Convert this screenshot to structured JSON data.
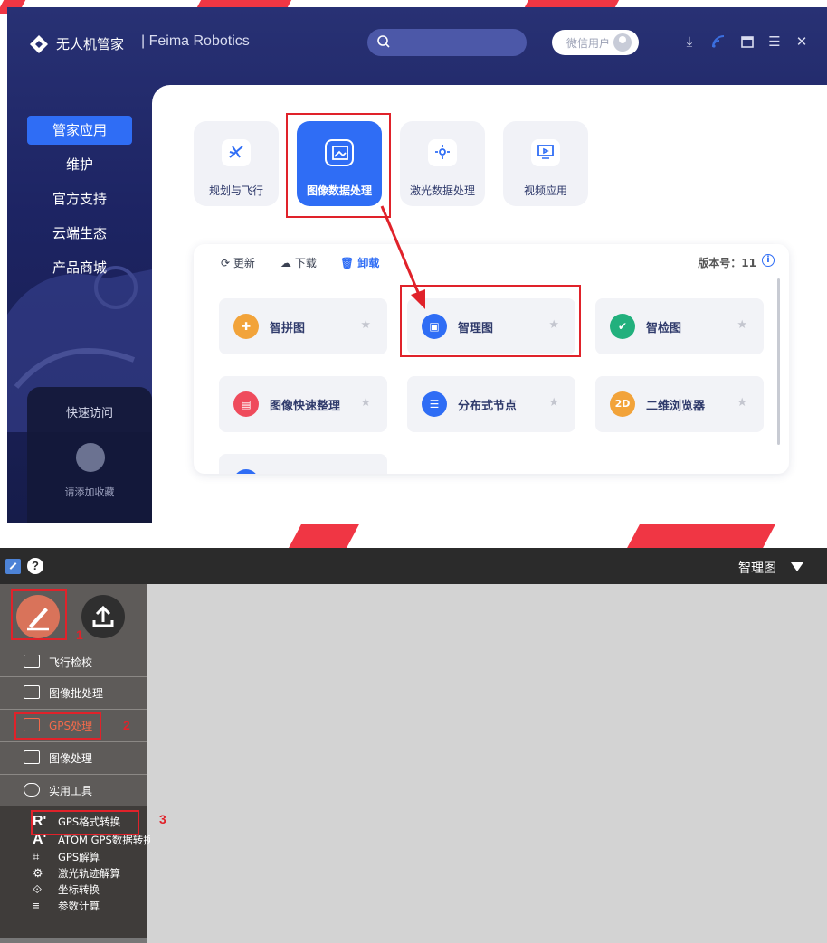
{
  "top_app": {
    "brand": "无人机管家",
    "brand_sub": "| Feima Robotics",
    "search": {
      "icon": "search-icon"
    },
    "user": {
      "label": "微信用户"
    },
    "toolbar_icons": [
      "download-icon",
      "signal-icon",
      "window-icon",
      "menu-icon",
      "close-icon"
    ],
    "sidebar": {
      "items": [
        {
          "label": "管家应用",
          "active": true
        },
        {
          "label": "维护",
          "active": false
        },
        {
          "label": "官方支持",
          "active": false
        },
        {
          "label": "云端生态",
          "active": false
        },
        {
          "label": "产品商城",
          "active": false
        }
      ],
      "quick_access": {
        "title": "快速访问",
        "hint": "请添加收藏"
      }
    },
    "categories": [
      {
        "label": "规划与飞行",
        "icon": "plane-icon",
        "active": false
      },
      {
        "label": "图像数据处理",
        "icon": "image-icon",
        "active": true
      },
      {
        "label": "激光数据处理",
        "icon": "laser-icon",
        "active": false
      },
      {
        "label": "视频应用",
        "icon": "video-icon",
        "active": false
      }
    ],
    "app_toolbar": {
      "update": "更新",
      "download": "下载",
      "uninstall": "卸载",
      "version": "版本号：11"
    },
    "apps": [
      {
        "label": "智拼图",
        "color": "#f2a33a",
        "glyph": "✚"
      },
      {
        "label": "智理图",
        "color": "#2f6df5",
        "glyph": "▣"
      },
      {
        "label": "智检图",
        "color": "#22b07d",
        "glyph": "✔"
      },
      {
        "label": "图像快速整理",
        "color": "#ef4b5c",
        "glyph": "▤"
      },
      {
        "label": "分布式节点",
        "color": "#2f6df5",
        "glyph": "☰"
      },
      {
        "label": "二维浏览器",
        "color": "#f2a33a",
        "glyph": "2D"
      }
    ]
  },
  "bottom_app": {
    "title": "智理图",
    "help": "?",
    "annotations": [
      "1",
      "2",
      "3"
    ],
    "menu": [
      {
        "label": "飞行检校",
        "active": false,
        "icon": "camera-icon"
      },
      {
        "label": "图像批处理",
        "active": false,
        "icon": "images-icon"
      },
      {
        "label": "GPS处理",
        "active": true,
        "icon": "satellite-icon"
      },
      {
        "label": "图像处理",
        "active": false,
        "icon": "image-process-icon"
      },
      {
        "label": "实用工具",
        "active": false,
        "icon": "tools-icon"
      }
    ],
    "sub_menu": [
      {
        "label": "GPS格式转换",
        "glyph": "ᵣR'"
      },
      {
        "label": "ATOM GPS数据转换",
        "glyph": "ᵣA'"
      },
      {
        "label": "GPS解算",
        "glyph": "⌗"
      },
      {
        "label": "激光轨迹解算",
        "glyph": "⚙"
      },
      {
        "label": "坐标转换",
        "glyph": "⟐"
      },
      {
        "label": "参数计算",
        "glyph": "≡"
      }
    ]
  }
}
